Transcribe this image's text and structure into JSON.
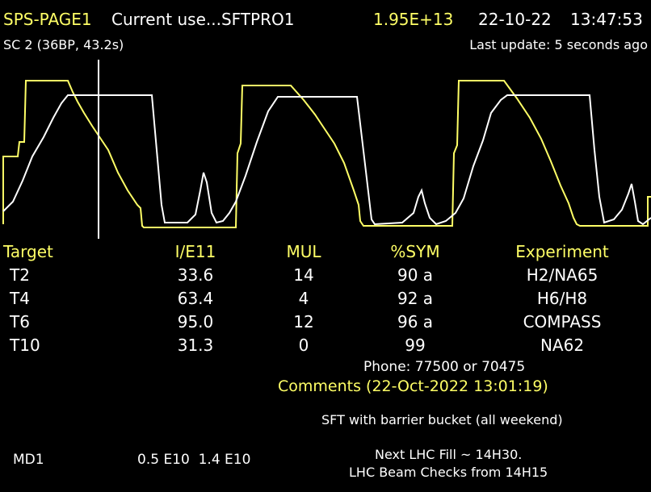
{
  "header": {
    "page_id": "SPS-PAGE1",
    "user": "Current use...SFTPRO1",
    "intensity": "1.95E+13",
    "date": "22-10-22",
    "time": "13:47:53"
  },
  "cycle": {
    "label": "SC 2 (36BP, 43.2s)",
    "last_update": "Last update: 5 seconds ago"
  },
  "colors": {
    "background": "#000000",
    "highlight": "#ffff66",
    "text": "#ffffff"
  },
  "chart_data": {
    "type": "line",
    "title": "",
    "series": [
      {
        "color": "#ffff66",
        "description": "intensity trace"
      },
      {
        "color": "#ffffff",
        "description": "magnet cycle trace"
      }
    ],
    "cursor": "vertical white line near start of first cycle"
  },
  "table": {
    "headers": [
      "Target",
      "I/E11",
      "MUL",
      "%SYM",
      "Experiment"
    ],
    "rows": [
      [
        "T2",
        "33.6",
        "14",
        "90 a",
        "H2/NA65"
      ],
      [
        "T4",
        "63.4",
        "4",
        "92 a",
        "H6/H8"
      ],
      [
        "T6",
        "95.0",
        "12",
        "96 a",
        "COMPASS"
      ],
      [
        "T10",
        "31.3",
        "0",
        "99",
        "NA62"
      ]
    ]
  },
  "phone": "Phone: 77500 or 70475",
  "comments": {
    "title": "Comments (22-Oct-2022 13:01:19)",
    "line1": "SFT with barrier bucket (all weekend)",
    "line2": "Next LHC Fill ~ 14H30.",
    "line3": "LHC Beam Checks from 14H15"
  },
  "footer": {
    "md_label": "MD1",
    "md_values": "0.5 E10  1.4 E10"
  }
}
